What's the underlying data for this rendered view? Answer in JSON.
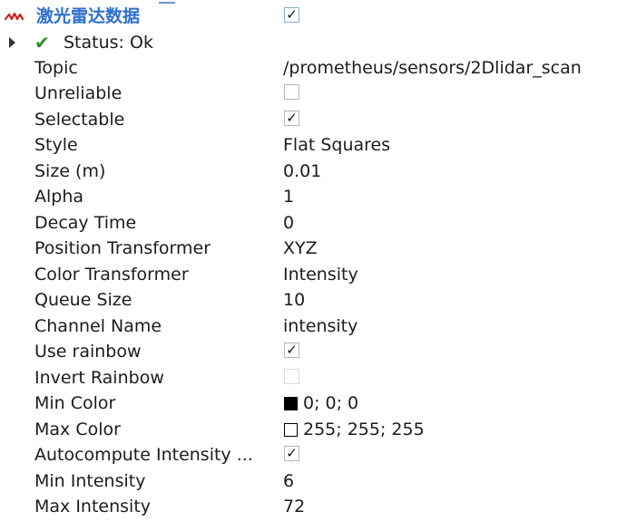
{
  "display": {
    "name": "激光雷达数据",
    "enabled": true,
    "icon": "laser-scan-icon",
    "icon_color": "#d22020",
    "name_color": "#2f6fd0"
  },
  "status": {
    "label": "Status: Ok",
    "icon": "check-icon",
    "icon_color": "#2e8b2e"
  },
  "properties": [
    {
      "name": "Topic",
      "type": "text",
      "value": "/prometheus/sensors/2Dlidar_scan"
    },
    {
      "name": "Unreliable",
      "type": "checkbox",
      "checked": false
    },
    {
      "name": "Selectable",
      "type": "checkbox",
      "checked": true
    },
    {
      "name": "Style",
      "type": "text",
      "value": "Flat Squares"
    },
    {
      "name": "Size (m)",
      "type": "text",
      "value": "0.01"
    },
    {
      "name": "Alpha",
      "type": "text",
      "value": "1"
    },
    {
      "name": "Decay Time",
      "type": "text",
      "value": "0"
    },
    {
      "name": "Position Transformer",
      "type": "text",
      "value": "XYZ"
    },
    {
      "name": "Color Transformer",
      "type": "text",
      "value": "Intensity"
    },
    {
      "name": "Queue Size",
      "type": "text",
      "value": "10"
    },
    {
      "name": "Channel Name",
      "type": "text",
      "value": "intensity"
    },
    {
      "name": "Use rainbow",
      "type": "checkbox",
      "checked": true
    },
    {
      "name": "Invert Rainbow",
      "type": "checkbox",
      "checked": false,
      "disabled": true
    },
    {
      "name": "Min Color",
      "type": "color",
      "value": "0; 0; 0",
      "swatch": "#000000"
    },
    {
      "name": "Max Color",
      "type": "color",
      "value": "255; 255; 255",
      "swatch": "#ffffff"
    },
    {
      "name": "Autocompute Intensity ...",
      "type": "checkbox",
      "checked": true
    },
    {
      "name": "Min Intensity",
      "type": "text",
      "value": "6"
    },
    {
      "name": "Max Intensity",
      "type": "text",
      "value": "72"
    }
  ]
}
